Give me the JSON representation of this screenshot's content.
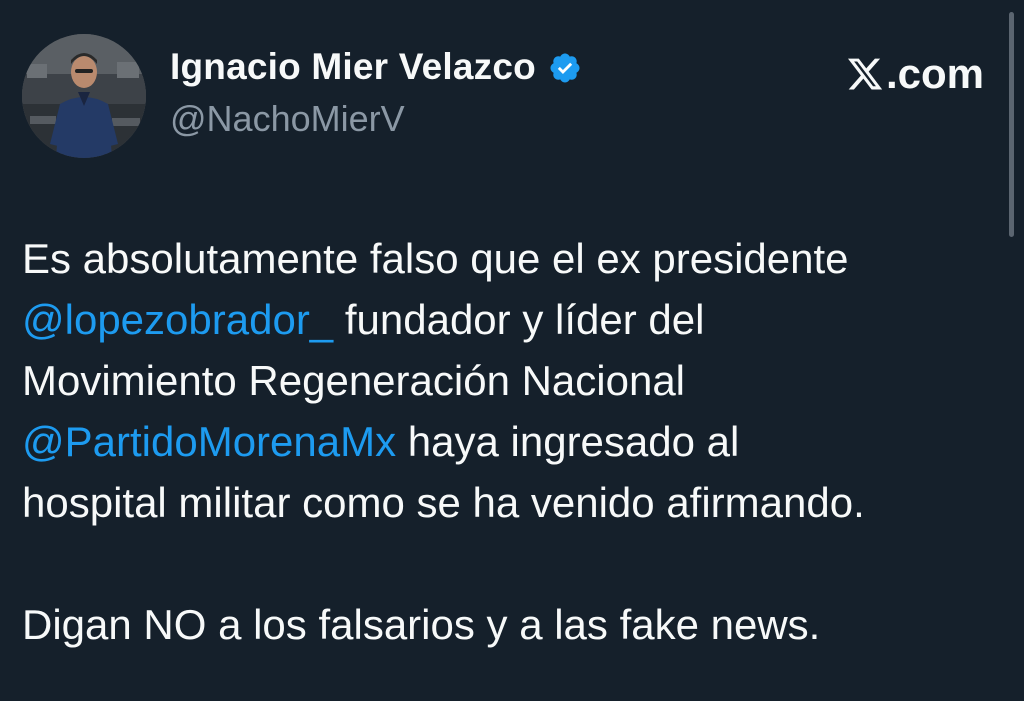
{
  "profile": {
    "display_name": "Ignacio Mier Velazco",
    "handle": "@NachoMierV",
    "verified_icon": "verified-badge-icon",
    "badge_color": "#1d9bf0"
  },
  "site": {
    "logo_text": ".com",
    "logo_icon": "x-logo-icon"
  },
  "tweet": {
    "line1": "Es absolutamente falso que el ex presidente",
    "mention1": "@lopezobrador_",
    "line2_rest": " fundador y líder del",
    "line3": "Movimiento Regeneración Nacional",
    "mention2": "@PartidoMorenaMx",
    "line4_rest": " haya ingresado al",
    "line5": "hospital militar como se ha venido afirmando.",
    "line6": "Digan NO a los falsarios y a las fake news."
  },
  "colors": {
    "background": "#15202b",
    "text": "#f7f9f9",
    "muted": "#8b98a5",
    "link": "#1d9bf0"
  }
}
